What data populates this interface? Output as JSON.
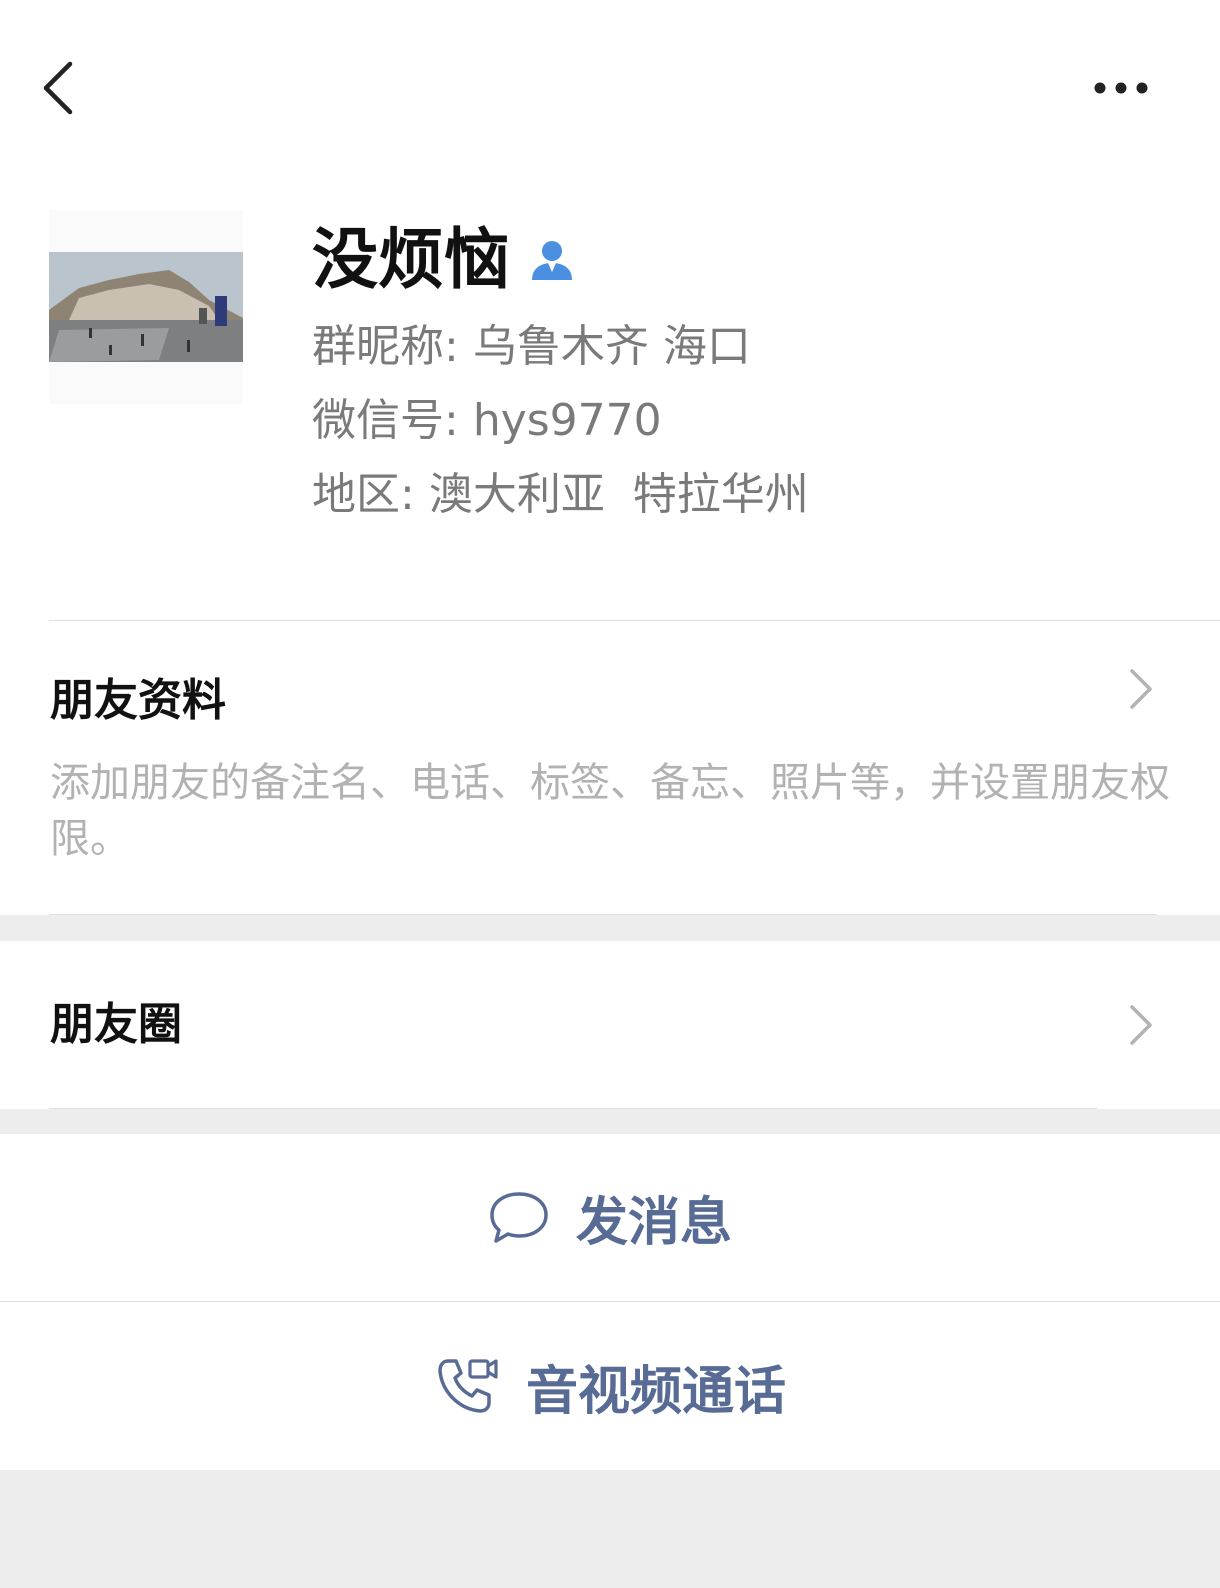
{
  "header": {
    "back_icon": "chevron-left-icon",
    "more_icon": "more-dots-icon"
  },
  "profile": {
    "nickname": "没烦恼",
    "contact_icon": "contact-person-icon",
    "group_nickname_label": "群昵称:",
    "group_nickname": "乌鲁木齐 海口",
    "wechat_id_label": "微信号:",
    "wechat_id": "hys9770",
    "region_label": "地区:",
    "region": "澳大利亚  特拉华州"
  },
  "friend_info": {
    "title": "朋友资料",
    "description": "添加朋友的备注名、电话、标签、备忘、照片等，并设置朋友权限。"
  },
  "moments": {
    "title": "朋友圈"
  },
  "actions": {
    "send_message": "发消息",
    "video_call": "音视频通话"
  },
  "colors": {
    "accent": "#576b95",
    "contact_icon": "#4a8fe0",
    "background": "#ededed"
  }
}
